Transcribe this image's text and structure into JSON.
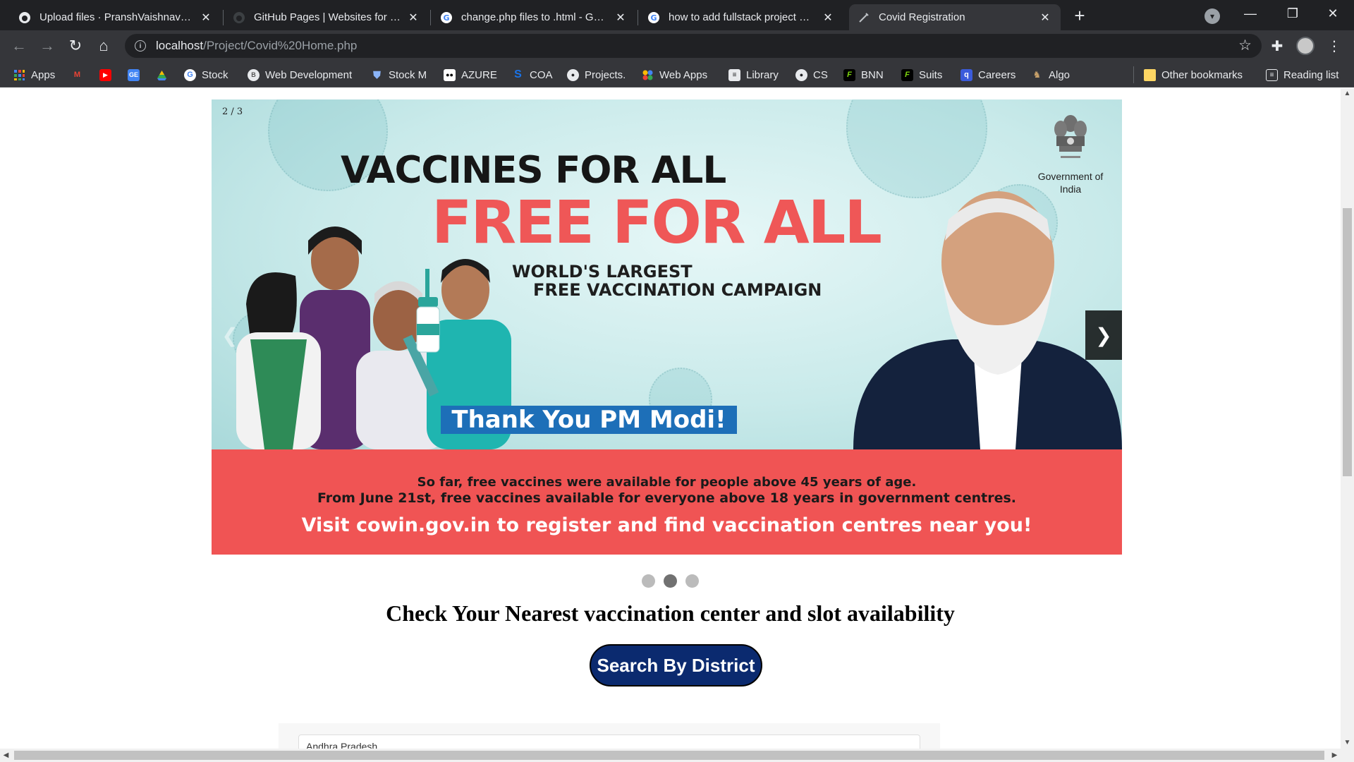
{
  "tabs": [
    {
      "title": "Upload files · PranshVaishnav/Co",
      "icon": "github-icon",
      "active": false
    },
    {
      "title": "GitHub Pages | Websites for you",
      "icon": "github-icon",
      "active": false
    },
    {
      "title": "change.php files to .html - Googl",
      "icon": "google-icon",
      "active": false
    },
    {
      "title": "how to add fullstack project on g",
      "icon": "google-icon",
      "active": false
    },
    {
      "title": "Covid Registration",
      "icon": "page-icon",
      "active": true
    }
  ],
  "address": {
    "host": "localhost",
    "path": "/Project/Covid%20Home.php"
  },
  "bookmarks": [
    {
      "label": "Apps",
      "icon": "apps-grid-icon",
      "color": "#4285f4"
    },
    {
      "label": "",
      "icon": "gmail-icon",
      "color": "#ea4335"
    },
    {
      "label": "",
      "icon": "youtube-icon",
      "color": "#ff0000"
    },
    {
      "label": "",
      "icon": "google-slides-icon",
      "color": "#4285f4"
    },
    {
      "label": "",
      "icon": "google-drive-icon",
      "color": "#34a853"
    },
    {
      "label": "Stock",
      "icon": "google-icon",
      "color": "#ffffff"
    },
    {
      "label": "Web Development",
      "icon": "bookmark-circle-icon",
      "color": "#f5c518"
    },
    {
      "label": "Stock M",
      "icon": "shield-icon",
      "color": "#8ab4f8"
    },
    {
      "label": "AZURE",
      "icon": "medium-icon",
      "color": "#ffffff"
    },
    {
      "label": "COA",
      "icon": "s-logo-icon",
      "color": "#1a73e8"
    },
    {
      "label": "Projects.",
      "icon": "github-icon",
      "color": "#ffffff"
    },
    {
      "label": "Web Apps",
      "icon": "colored-dots-icon",
      "color": "#fbbc04"
    },
    {
      "label": "Library",
      "icon": "library-icon",
      "color": "#ffffff"
    },
    {
      "label": "CS",
      "icon": "github-icon",
      "color": "#ffffff"
    },
    {
      "label": "BNN",
      "icon": "f-logo-icon",
      "color": "#7cd40e"
    },
    {
      "label": "Suits",
      "icon": "f-logo-icon",
      "color": "#7cd40e"
    },
    {
      "label": "Careers",
      "icon": "q-logo-icon",
      "color": "#3b5bdb"
    },
    {
      "label": "Algo",
      "icon": "algo-icon",
      "color": "#c8a16a"
    }
  ],
  "bookmarks_right": [
    {
      "label": "Other bookmarks",
      "icon": "folder-icon"
    },
    {
      "label": "Reading list",
      "icon": "reading-list-icon"
    }
  ],
  "slide": {
    "counter": "2 / 3",
    "headline1": "VACCINES FOR ALL",
    "headline2": "FREE FOR ALL",
    "headline3a": "WORLD'S LARGEST",
    "headline3b": "FREE VACCINATION CAMPAIGN",
    "thank_you": "Thank You PM Modi!",
    "govt_line1": "Government of",
    "govt_line2": "India",
    "info1": "So far, free vaccines were available for people above 45 years of age.",
    "info2": "From June 21st, free vaccines available for everyone above 18 years in government centres.",
    "info3": "Visit cowin.gov.in to register and find vaccination centres near you!",
    "next": "❯",
    "prev": "❮"
  },
  "dots": {
    "count": 3,
    "active_index": 1
  },
  "main": {
    "heading": "Check Your Nearest vaccination center and slot availability",
    "search_button": "Search By District",
    "form_placeholder": "Andhra Pradesh"
  },
  "colors": {
    "accent_red": "#f05454",
    "button_navy": "#0b2a6f",
    "banner_blue": "#1d6fb8"
  }
}
